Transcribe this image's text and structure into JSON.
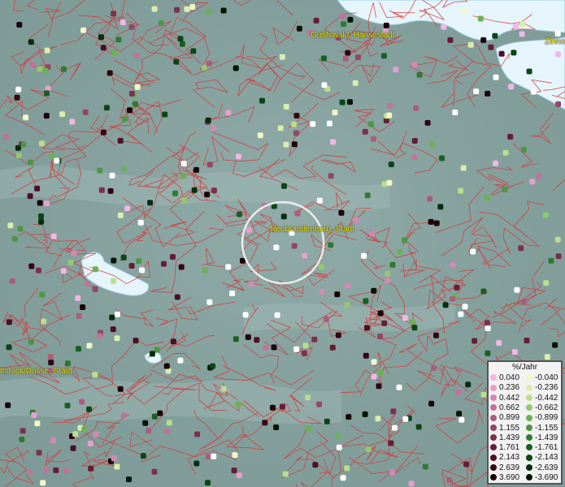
{
  "map": {
    "labels": {
      "greifswald": "Greifswald, Hansestadt",
      "neubrandenburg": "Neubrandenburg, Stadt",
      "wittstock": "ttstock/Dosse, Stadt",
      "zinnowitz": "Zinno"
    }
  },
  "legend": {
    "unit": "%/Jahr",
    "positive": [
      {
        "label": "0.040",
        "color": "#f2b6e6"
      },
      {
        "label": "0.236",
        "color": "#e79fce"
      },
      {
        "label": "0.442",
        "color": "#d488b4"
      },
      {
        "label": "0.662",
        "color": "#c07398"
      },
      {
        "label": "0.899",
        "color": "#ab5d7e"
      },
      {
        "label": "1.155",
        "color": "#944665"
      },
      {
        "label": "1.439",
        "color": "#7c304c"
      },
      {
        "label": "1.761",
        "color": "#651d36"
      },
      {
        "label": "2.143",
        "color": "#4c0f23"
      },
      {
        "label": "2.639",
        "color": "#330513"
      },
      {
        "label": "3.690",
        "color": "#1a0008"
      }
    ],
    "negative": [
      {
        "label": "-0.040",
        "color": "#f2f7c6"
      },
      {
        "label": "-0.236",
        "color": "#d9eeaa"
      },
      {
        "label": "-0.442",
        "color": "#b8de8c"
      },
      {
        "label": "-0.662",
        "color": "#93c870"
      },
      {
        "label": "-0.899",
        "color": "#6db057"
      },
      {
        "label": "-1.155",
        "color": "#4d9643"
      },
      {
        "label": "-1.439",
        "color": "#2f7a31"
      },
      {
        "label": "-1.761",
        "color": "#1a5e22"
      },
      {
        "label": "-2.143",
        "color": "#0c4516"
      },
      {
        "label": "-2.639",
        "color": "#042d0c"
      },
      {
        "label": "-3.690",
        "color": "#001504"
      }
    ]
  },
  "colors": {
    "border": "#d43a3a",
    "water": "#e8f6fb",
    "land": "#86a3a0"
  }
}
